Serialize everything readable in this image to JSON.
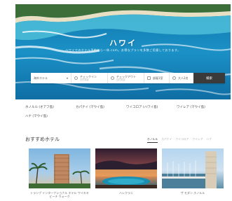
{
  "hero": {
    "title": "ハワイ",
    "subtitle": "ハワイでのホテル予約なら一休.com。お得なプランを多数ご用意しております。"
  },
  "search": {
    "destination": "海外ホテル",
    "checkin_label": "チェックイン",
    "checkin_value": "日付未定",
    "checkout_label": "チェックアウト",
    "checkout_value": "日付未定",
    "rooms": "部屋1室",
    "guests": "大人2名",
    "button": "検索"
  },
  "areas": {
    "row1": [
      "ホノルル (オアフ島)",
      "カパナイ (マウイ島)",
      "ワイコロア (ハワイ島)",
      "ワイレア (マウイ島)"
    ],
    "row2": [
      "ハナ (マウイ島)"
    ]
  },
  "recommended": {
    "title": "おすすめホテル",
    "tabs": [
      "ホノルル",
      "カパナイ",
      "ワイコロア",
      "ワイレア",
      "ハナ"
    ],
    "cards": [
      {
        "name": "トランプ インターナショナル ホテル ワイキキ ビーチ ウォーク"
      },
      {
        "name": "ハレクラニ"
      },
      {
        "name": "ザ モダン ホノルル"
      }
    ]
  }
}
